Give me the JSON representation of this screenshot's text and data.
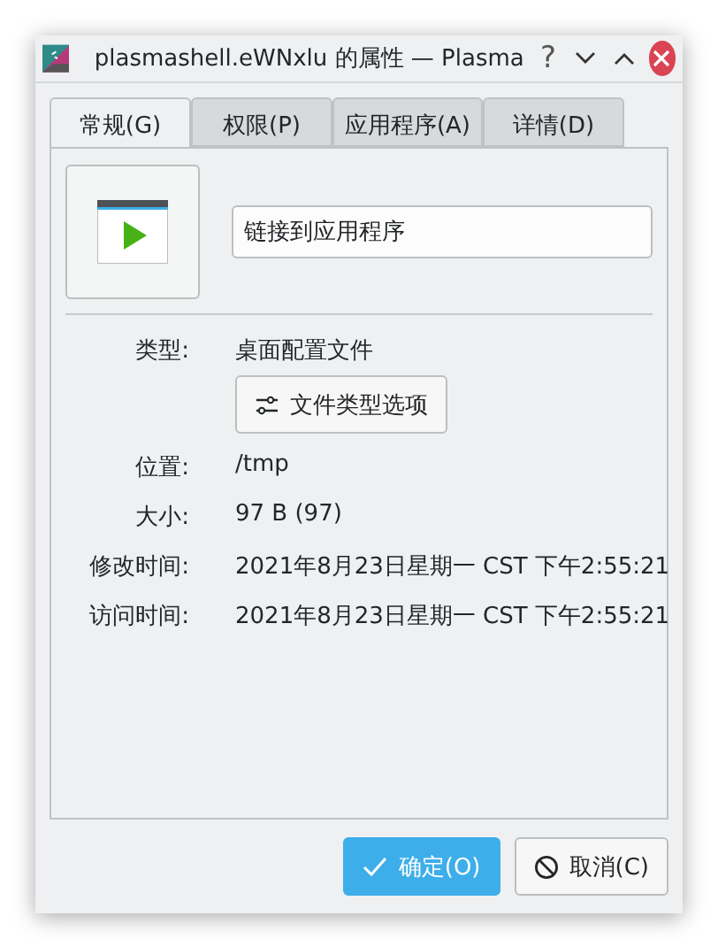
{
  "window": {
    "title": "plasmashell.eWNxlu 的属性 — Plasma",
    "controls": [
      {
        "kind": "help",
        "label": "?"
      },
      {
        "kind": "minimize"
      },
      {
        "kind": "maximize"
      },
      {
        "kind": "close"
      }
    ]
  },
  "tabs": [
    {
      "label": "常规(G)",
      "selected": true
    },
    {
      "label": "权限(P)",
      "selected": false
    },
    {
      "label": "应用程序(A)",
      "selected": false
    },
    {
      "label": "详情(D)",
      "selected": false
    }
  ],
  "name_field": {
    "value": "链接到应用程序"
  },
  "properties": [
    {
      "label": "类型:",
      "value": "桌面配置文件",
      "button": "文件类型选项"
    },
    {
      "label": "位置:",
      "value": "/tmp"
    },
    {
      "label": "大小:",
      "value": "97 B (97)"
    },
    {
      "label": "修改时间:",
      "value": "2021年8月23日星期一 CST 下午2:55:21"
    },
    {
      "label": "访问时间:",
      "value": "2021年8月23日星期一 CST 下午2:55:21"
    }
  ],
  "buttons": [
    {
      "kind": "ok",
      "label": "确定(O)"
    },
    {
      "kind": "cancel",
      "label": "取消(C)"
    }
  ]
}
